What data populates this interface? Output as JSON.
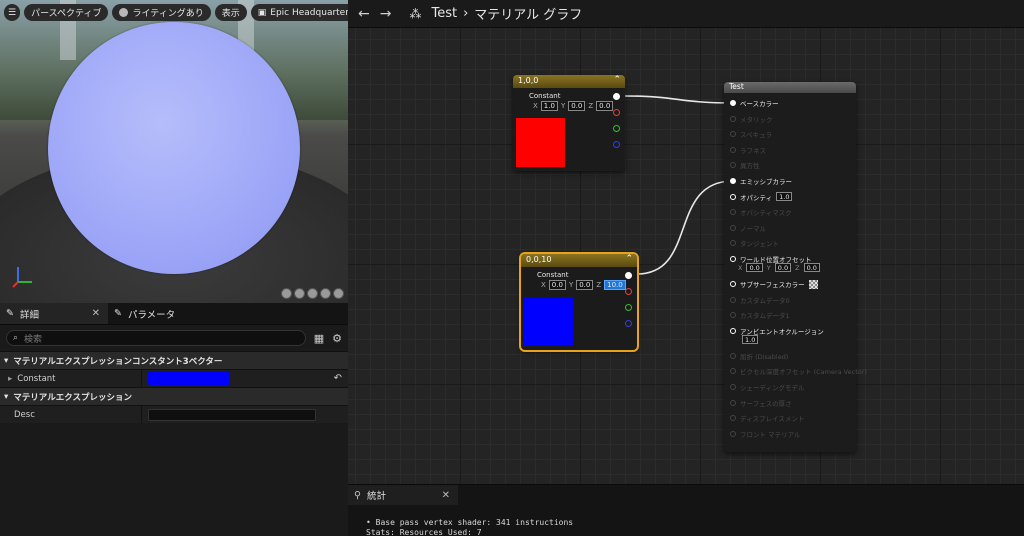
{
  "viewport": {
    "toolbar": {
      "menu_icon": "hamburger-icon",
      "perspective": "パースペクティブ",
      "lighting": "ライティングあり",
      "show": "表示",
      "scene": "Epic Headquarters"
    }
  },
  "details": {
    "tabs": [
      {
        "label": "詳細",
        "icon": "brush-icon",
        "close": "✕"
      },
      {
        "label": "パラメータ",
        "icon": "brush-icon"
      }
    ],
    "search_placeholder": "検索",
    "sections": [
      {
        "title": "マテリアルエクスプレッションコンスタント3ベクター",
        "props": [
          {
            "name": "Constant",
            "color": "#0000ff"
          }
        ]
      },
      {
        "title": "マテリアルエクスプレッション",
        "props": [
          {
            "name": "Desc",
            "value": ""
          }
        ]
      }
    ]
  },
  "graph": {
    "back": "←",
    "forward": "→",
    "asset": "Test",
    "separator": "›",
    "title": "マテリアル グラフ",
    "node1": {
      "header": "1,0,0",
      "label": "Constant",
      "x": "1.0",
      "y": "0.0",
      "z": "0.0",
      "color": "#ff0000",
      "axis": {
        "x": "X",
        "y": "Y",
        "z": "Z"
      }
    },
    "node2": {
      "header": "0,0,10",
      "label": "Constant",
      "x": "0.0",
      "y": "0.0",
      "z": "10.0",
      "color": "#0000ff",
      "axis": {
        "x": "X",
        "y": "Y",
        "z": "Z"
      }
    },
    "result": {
      "header": "Test",
      "inputs": [
        {
          "label": "ベースカラー",
          "on": true
        },
        {
          "label": "メタリック",
          "on": false
        },
        {
          "label": "スペキュラ",
          "on": false
        },
        {
          "label": "ラフネス",
          "on": false
        },
        {
          "label": "異方性",
          "on": false
        },
        {
          "label": "エミッシブカラー",
          "on": true
        },
        {
          "label": "オパシティ",
          "on": true,
          "value": "1.0"
        },
        {
          "label": "オパシティマスク",
          "on": false
        },
        {
          "label": "ノーマル",
          "on": false
        },
        {
          "label": "タンジェント",
          "on": false
        },
        {
          "label": "ワールド位置オフセット",
          "on": true,
          "vec": [
            "0.0",
            "0.0",
            "0.0"
          ]
        },
        {
          "label": "サブサーフェスカラー",
          "on": true,
          "checker": true
        },
        {
          "label": "カスタムデータ0",
          "on": false
        },
        {
          "label": "カスタムデータ1",
          "on": false
        },
        {
          "label": "アンビエントオクルージョン",
          "on": true,
          "value": "1.0"
        },
        {
          "label": "屈折 (Disabled)",
          "on": false
        },
        {
          "label": "ピクセル深度オフセット (Camera Vector)",
          "on": false
        },
        {
          "label": "シェーディングモデル",
          "on": false
        },
        {
          "label": "サーフェスの厚さ",
          "on": false
        },
        {
          "label": "ディスプレイスメント",
          "on": false
        },
        {
          "label": "フロント マテリアル",
          "on": false
        }
      ]
    }
  },
  "stats": {
    "tab": "統計",
    "close": "✕",
    "lines": [
      "•  Base pass vertex shader: 341 instructions",
      "   Stats: Resources Used: 7"
    ]
  }
}
